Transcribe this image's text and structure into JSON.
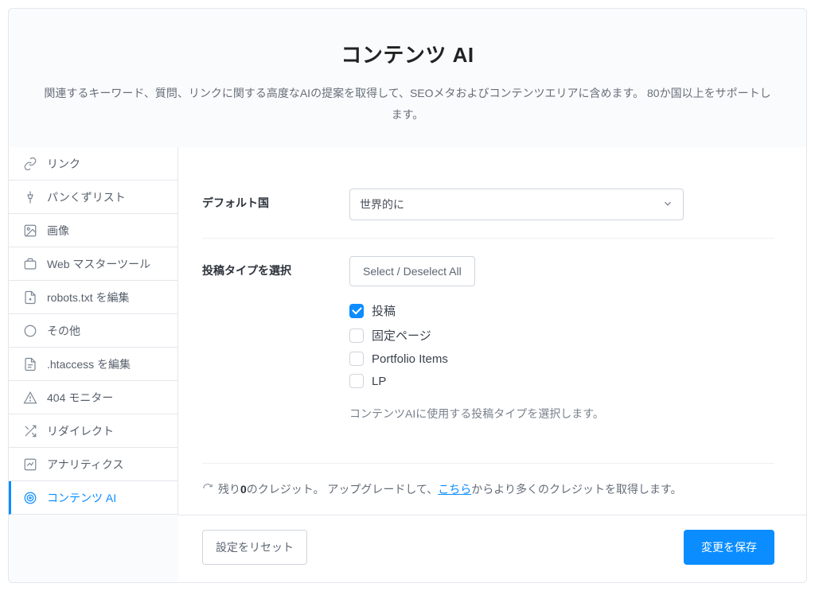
{
  "header": {
    "title": "コンテンツ AI",
    "description": "関連するキーワード、質問、リンクに関する高度なAIの提案を取得して、SEOメタおよびコンテンツエリアに含めます。 80か国以上をサポートします。"
  },
  "sidebar": {
    "items": [
      {
        "id": "links",
        "label": "リンク",
        "icon": "link-icon"
      },
      {
        "id": "breadcrumbs",
        "label": "パンくずリスト",
        "icon": "pin-icon"
      },
      {
        "id": "images",
        "label": "画像",
        "icon": "image-icon"
      },
      {
        "id": "webmaster",
        "label": "Web マスターツール",
        "icon": "briefcase-icon"
      },
      {
        "id": "robots",
        "label": "robots.txt を編集",
        "icon": "file-icon"
      },
      {
        "id": "other",
        "label": "その他",
        "icon": "circle-icon"
      },
      {
        "id": "htaccess",
        "label": ".htaccess を編集",
        "icon": "doc-icon"
      },
      {
        "id": "404",
        "label": "404 モニター",
        "icon": "warning-icon"
      },
      {
        "id": "redirects",
        "label": "リダイレクト",
        "icon": "shuffle-icon"
      },
      {
        "id": "analytics",
        "label": "アナリティクス",
        "icon": "chart-icon"
      },
      {
        "id": "content-ai",
        "label": "コンテンツ AI",
        "icon": "target-icon"
      }
    ],
    "active": "content-ai"
  },
  "form": {
    "default_country": {
      "label": "デフォルト国",
      "value": "世界的に"
    },
    "post_types": {
      "label": "投稿タイプを選択",
      "toggle_all_label": "Select / Deselect All",
      "options": [
        {
          "id": "posts",
          "label": "投稿",
          "checked": true
        },
        {
          "id": "pages",
          "label": "固定ページ",
          "checked": false
        },
        {
          "id": "portfolio",
          "label": "Portfolio Items",
          "checked": false
        },
        {
          "id": "lp",
          "label": "LP",
          "checked": false
        }
      ],
      "help": "コンテンツAIに使用する投稿タイプを選択します。"
    }
  },
  "credits": {
    "prefix": "残り",
    "count": "0",
    "mid1": "のクレジット。 アップグレードして、",
    "link_label": "こちら",
    "suffix": "からより多くのクレジットを取得します。"
  },
  "footer": {
    "reset_label": "設定をリセット",
    "save_label": "変更を保存"
  }
}
